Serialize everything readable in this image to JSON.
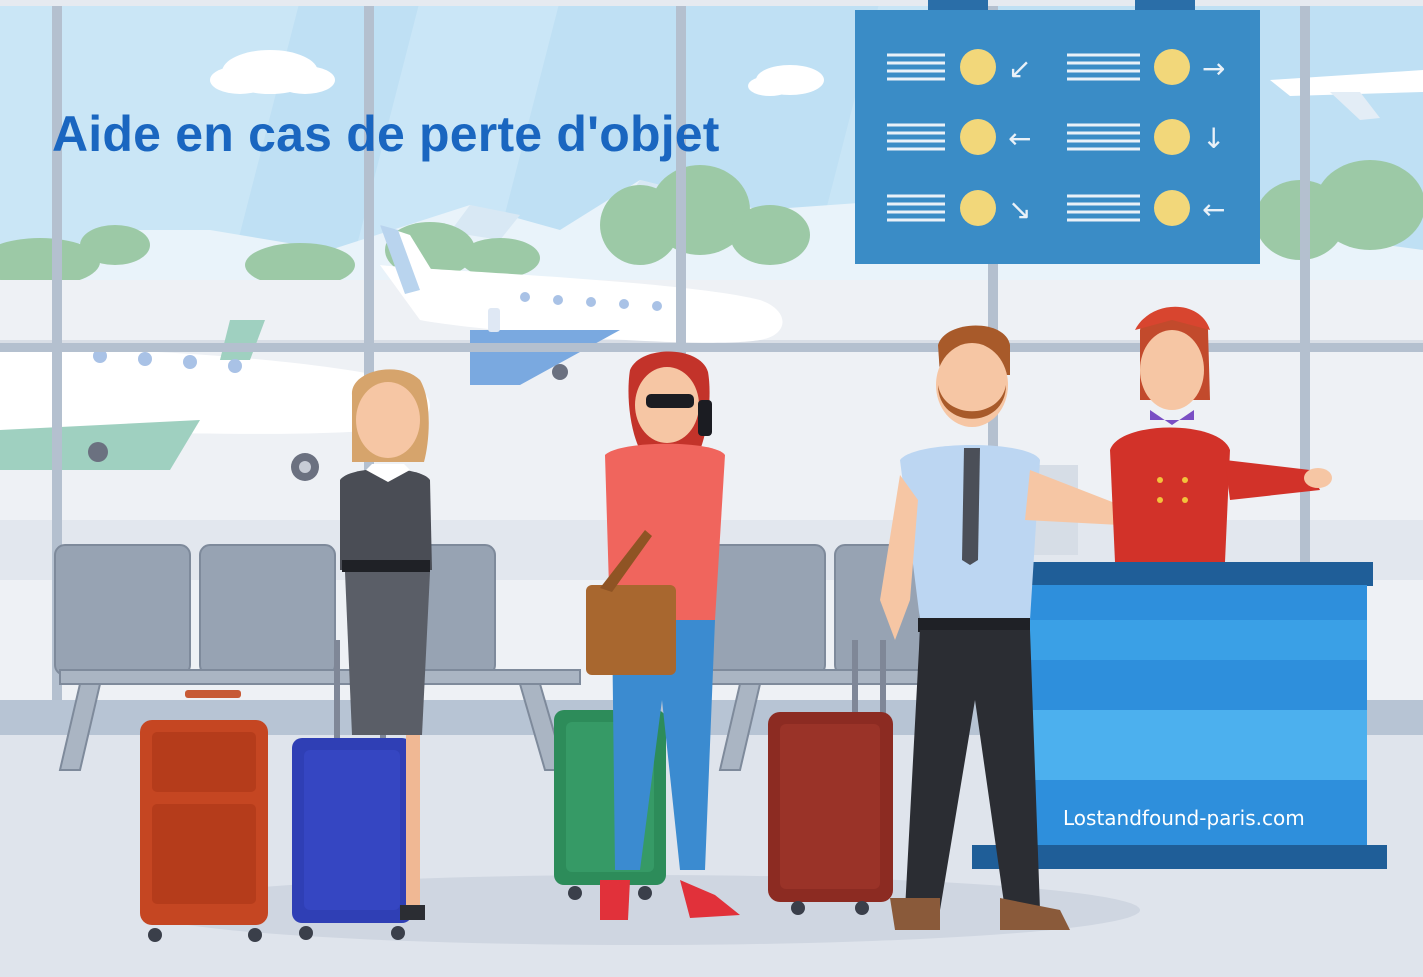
{
  "image": {
    "description": "",
    "headline": "Aide en cas de perte d'objet",
    "desk_url": "Lostandfound-paris.com"
  },
  "colors": {
    "headline": "#1a66c0",
    "sky": "#bfe0f4",
    "board": "#3a8cc6",
    "desk": "#2e8fdc"
  },
  "board": {
    "rows": [
      {
        "left_arrow": "↙",
        "right_arrow": "→"
      },
      {
        "left_arrow": "←",
        "right_arrow": "↓"
      },
      {
        "left_arrow": "↘",
        "right_arrow": "←"
      }
    ]
  }
}
